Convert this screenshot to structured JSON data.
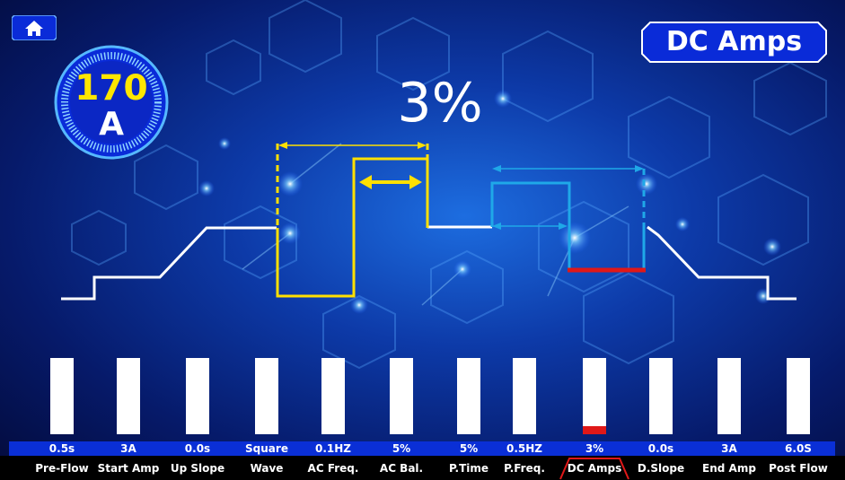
{
  "header": {
    "home_icon": "home-icon",
    "param_title": "DC Amps"
  },
  "dial": {
    "value": "170",
    "unit": "A"
  },
  "big_value": "3%",
  "colors": {
    "waveform_base": "#ffffff",
    "ac_wave": "#ffe000",
    "pulse_wave": "#1fa8e8",
    "highlight": "#e01818",
    "strip_blue": "#0a2fd6",
    "title_frame": "#0a2bd8"
  },
  "params": [
    {
      "label": "Pre-Flow",
      "value": "0.5s"
    },
    {
      "label": "Start Amp",
      "value": "3A"
    },
    {
      "label": "Up Slope",
      "value": "0.0s"
    },
    {
      "label": "Wave",
      "value": "Square"
    },
    {
      "label": "AC Freq.",
      "value": "0.1HZ"
    },
    {
      "label": "AC Bal.",
      "value": "5%"
    },
    {
      "label": "P.Time",
      "value": "5%"
    },
    {
      "label": "P.Freq.",
      "value": "0.5HZ"
    },
    {
      "label": "DC Amps",
      "value": "3%"
    },
    {
      "label": "D.Slope",
      "value": "0.0s"
    },
    {
      "label": "End Amp",
      "value": "3A"
    },
    {
      "label": "Post Flow",
      "value": "6.0S"
    }
  ],
  "selected_param": "DC Amps",
  "selected_level": 0.1
}
